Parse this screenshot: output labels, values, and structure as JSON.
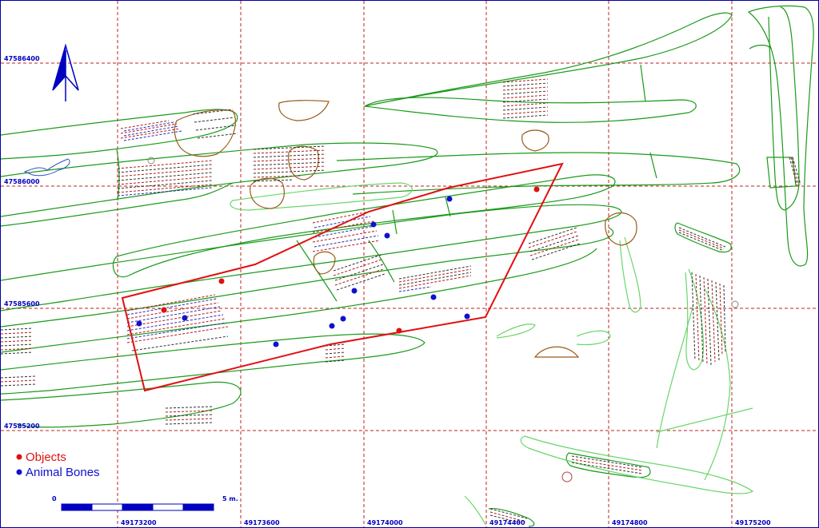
{
  "map": {
    "x_labels": [
      "49173200",
      "49173600",
      "49174000",
      "49174400",
      "49174800",
      "49175200"
    ],
    "y_labels": [
      "47586400",
      "47586000",
      "47585600",
      "47585200"
    ],
    "colors": {
      "grid": "#c02020",
      "coord_text": "#0000c0",
      "trench_outline": "#1a9a1a",
      "trench_outline_light": "#6ad66a",
      "pit_outline": "#9a5a1a",
      "boundary": "#e01010",
      "object_point": "#e01010",
      "bone_point": "#1010d0",
      "north_arrow": "#0000c0"
    },
    "north_arrow_icon": "north-arrow-icon"
  },
  "legend": {
    "objects_label": "Objects",
    "animal_bones_label": "Animal Bones"
  },
  "scale_bar": {
    "start_label": "0",
    "end_label": "5 m."
  }
}
